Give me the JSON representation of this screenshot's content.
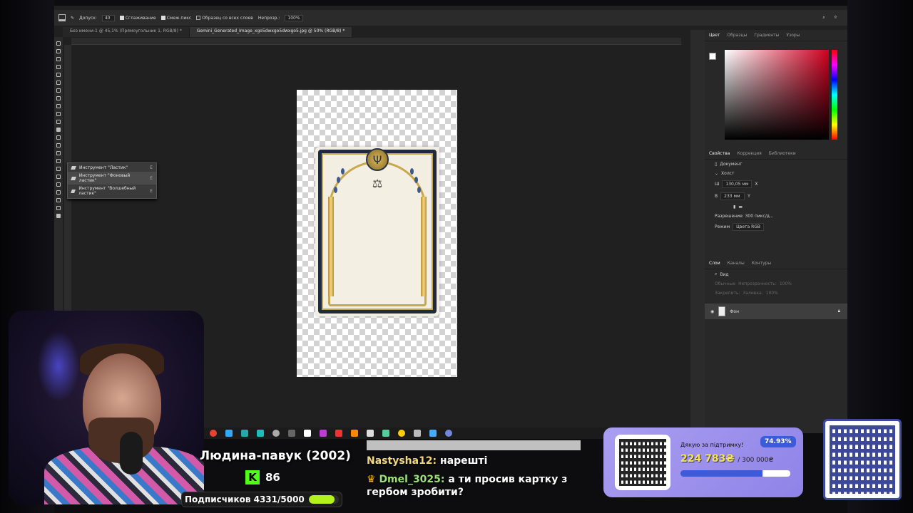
{
  "options_bar": {
    "tolerance_label": "Допуск:",
    "tolerance_value": "40",
    "antialias_label": "Сглаживание",
    "contiguous_label": "Смеж.пикс",
    "sample_all_label": "Образец со всех слоев",
    "opacity_label": "Непрозр.:",
    "opacity_value": "100%"
  },
  "tabs": [
    {
      "label": "Без имени-1 @ 45,1% (Прямоугольник 1, RGB/8) *"
    },
    {
      "label": "Gemini_Generated_Image_xgo5dwxgo5dwxgo5.jpg @ 50% (RGB/8) *"
    }
  ],
  "tool_flyout": {
    "items": [
      {
        "label": "Инструмент \"Ластик\"",
        "key": "E"
      },
      {
        "label": "Инструмент \"Фоновый ластик\"",
        "key": "E"
      },
      {
        "label": "Инструмент \"Волшебный ластик\"",
        "key": "E"
      }
    ]
  },
  "color_panel": {
    "tabs": [
      "Цвет",
      "Образцы",
      "Градиенты",
      "Узоры"
    ],
    "accent": "#d00020"
  },
  "properties": {
    "tabs": [
      "Свойства",
      "Коррекция",
      "Библиотеки"
    ],
    "doc_label": "Документ",
    "canvas_label": "Холст",
    "width_label": "Ш",
    "width_value": "130,05 мм",
    "height_label": "В",
    "height_value": "233 мм",
    "x_label": "X",
    "y_label": "Y",
    "resolution": "Разрешение: 300 пикс/д...",
    "mode_label": "Режим",
    "mode_value": "Цвета RGB"
  },
  "layers": {
    "tabs": [
      "Слои",
      "Каналы",
      "Контуры"
    ],
    "kind_placeholder": "Вид",
    "blend_mode": "Обычные",
    "opacity_label": "Непрозрачность:",
    "opacity_value": "100%",
    "lock_label": "Закрепить:",
    "fill_label": "Заливка:",
    "fill_value": "100%",
    "layer_name": "Фон"
  },
  "stream": {
    "title": "Людина-павук (2002)",
    "kick_count": "86",
    "subscribers": "Подписчиков 4331/5000",
    "subscriber_progress": 0.8662
  },
  "chat": [
    {
      "user": "Nastysha12:",
      "text": "нарешті",
      "color": "#f3d97a"
    },
    {
      "user": "Dmel_3025:",
      "text": "а ти просив картку з гербом зробити?",
      "color": "#9be36f"
    }
  ],
  "donation": {
    "thanks": "Дякую за підтримку!",
    "amount": "224 783₴",
    "goal": "/ 300 000₴",
    "percent": "74.93%",
    "progress": 0.7493
  }
}
